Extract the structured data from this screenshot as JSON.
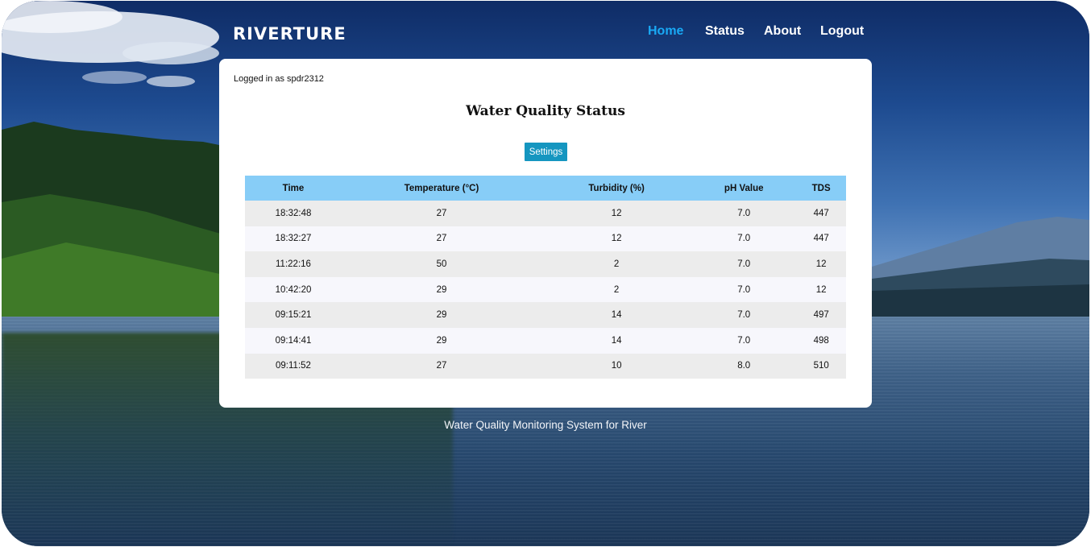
{
  "brand": {
    "logo_text": "RIVERTURE"
  },
  "nav": {
    "items": [
      {
        "label": "Home",
        "active": true
      },
      {
        "label": "Status",
        "active": false
      },
      {
        "label": "About",
        "active": false
      },
      {
        "label": "Logout",
        "active": false
      }
    ]
  },
  "card": {
    "logged_in_text": "Logged in as spdr2312",
    "title": "Water Quality Status",
    "settings_label": "Settings"
  },
  "table": {
    "headers": [
      "Time",
      "Temperature (°C)",
      "Turbidity (%)",
      "pH Value",
      "TDS"
    ],
    "rows": [
      [
        "18:32:48",
        "27",
        "12",
        "7.0",
        "447"
      ],
      [
        "18:32:27",
        "27",
        "12",
        "7.0",
        "447"
      ],
      [
        "11:22:16",
        "50",
        "2",
        "7.0",
        "12"
      ],
      [
        "10:42:20",
        "29",
        "2",
        "7.0",
        "12"
      ],
      [
        "09:15:21",
        "29",
        "14",
        "7.0",
        "497"
      ],
      [
        "09:14:41",
        "29",
        "14",
        "7.0",
        "498"
      ],
      [
        "09:11:52",
        "27",
        "10",
        "8.0",
        "510"
      ]
    ]
  },
  "footer": {
    "text": "Water Quality Monitoring System for River"
  },
  "colors": {
    "nav_active": "#19a9f5",
    "table_header": "#87cdf7",
    "settings_button": "#1596c0"
  }
}
